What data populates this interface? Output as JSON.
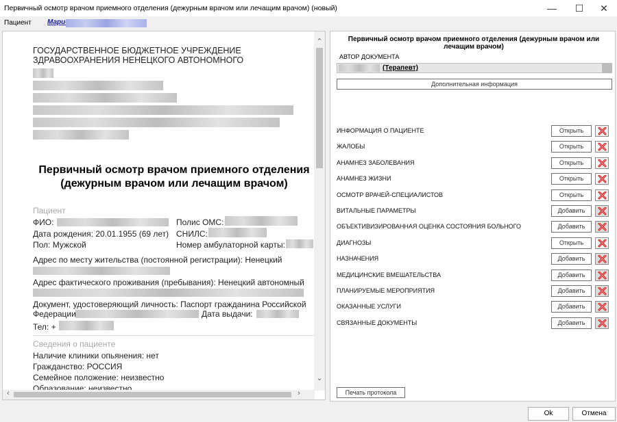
{
  "window": {
    "title": "Первичный осмотр врачом приемного отделения (дежурным врачом или лечащим врачом) (новый)"
  },
  "patient_bar": {
    "label": "Пациент",
    "link": "Марио"
  },
  "document": {
    "org": [
      "ГОСУДАРСТВЕННОЕ БЮДЖЕТНОЕ УЧРЕЖДЕНИЕ",
      "ЗДРАВООХРАНЕНИЯ НЕНЕЦКОГО АВТОНОМНОГО"
    ],
    "title": [
      "Первичный осмотр врачом приемного отделения",
      "(дежурным врачом или лечащим врачом)"
    ],
    "patient_section": "Пациент",
    "fio": "ФИО:",
    "polis": "Полис ОМС:",
    "dob": "Дата рождения: 20.01.1955 (69 лет)",
    "snils": "СНИЛС:",
    "sex": "Пол: Мужской",
    "card": "Номер амбулаторной карты:",
    "addr_reg": "Адрес по месту жительства (постоянной регистрации): Ненецкий",
    "addr_fact": "Адрес фактического проживания (пребывания): Ненецкий автономный",
    "id_doc": "Документ, удостоверяющий личность: Паспорт гражданина Российской",
    "federation": "Федерации",
    "issue_date": "Дата выдачи:",
    "phone": "Тел: +",
    "info_section": "Сведения о пациенте",
    "intox": "Наличие клиники опьянения: нет",
    "citizenship": "Гражданство: РОССИЯ",
    "family": "Семейное положение: неизвестно",
    "education": "Образование: неизвестно"
  },
  "right": {
    "title": [
      "Первичный осмотр врачом приемного отделения (дежурным врачом или",
      "лечащим врачом)"
    ],
    "author_label": "АВТОР ДОКУМЕНТА",
    "author_role": "(Терапевт)",
    "more_info": "Дополнительная информация",
    "sections": [
      {
        "label": "ИНФОРМАЦИЯ О ПАЦИЕНТЕ",
        "action": "Открыть"
      },
      {
        "label": "ЖАЛОБЫ",
        "action": "Открыть"
      },
      {
        "label": "АНАМНЕЗ ЗАБОЛЕВАНИЯ",
        "action": "Открыть"
      },
      {
        "label": "АНАМНЕЗ ЖИЗНИ",
        "action": "Открыть"
      },
      {
        "label": "ОСМОТР ВРАЧЕЙ-СПЕЦИАЛИСТОВ",
        "action": "Открыть"
      },
      {
        "label": "ВИТАЛЬНЫЕ ПАРАМЕТРЫ",
        "action": "Добавить"
      },
      {
        "label": "ОБЪЕКТИВИЗИРОВАННАЯ ОЦЕНКА СОСТОЯНИЯ БОЛЬНОГО",
        "action": "Добавить"
      },
      {
        "label": "ДИАГНОЗЫ",
        "action": "Открыть"
      },
      {
        "label": "НАЗНАЧЕНИЯ",
        "action": "Добавить"
      },
      {
        "label": "МЕДИЦИНСКИЕ ВМЕШАТЕЛЬСТВА",
        "action": "Добавить"
      },
      {
        "label": "ПЛАНИРУЕМЫЕ МЕРОПРИЯТИЯ",
        "action": "Добавить"
      },
      {
        "label": "ОКАЗАННЫЕ УСЛУГИ",
        "action": "Добавить"
      },
      {
        "label": "СВЯЗАННЫЕ ДОКУМЕНТЫ",
        "action": "Добавить"
      }
    ],
    "print": "Печать протокола"
  },
  "footer": {
    "ok": "Ok",
    "cancel": "Отмена"
  },
  "colors": {
    "delete_icon": "#d62020",
    "link": "#1a1aa6"
  }
}
